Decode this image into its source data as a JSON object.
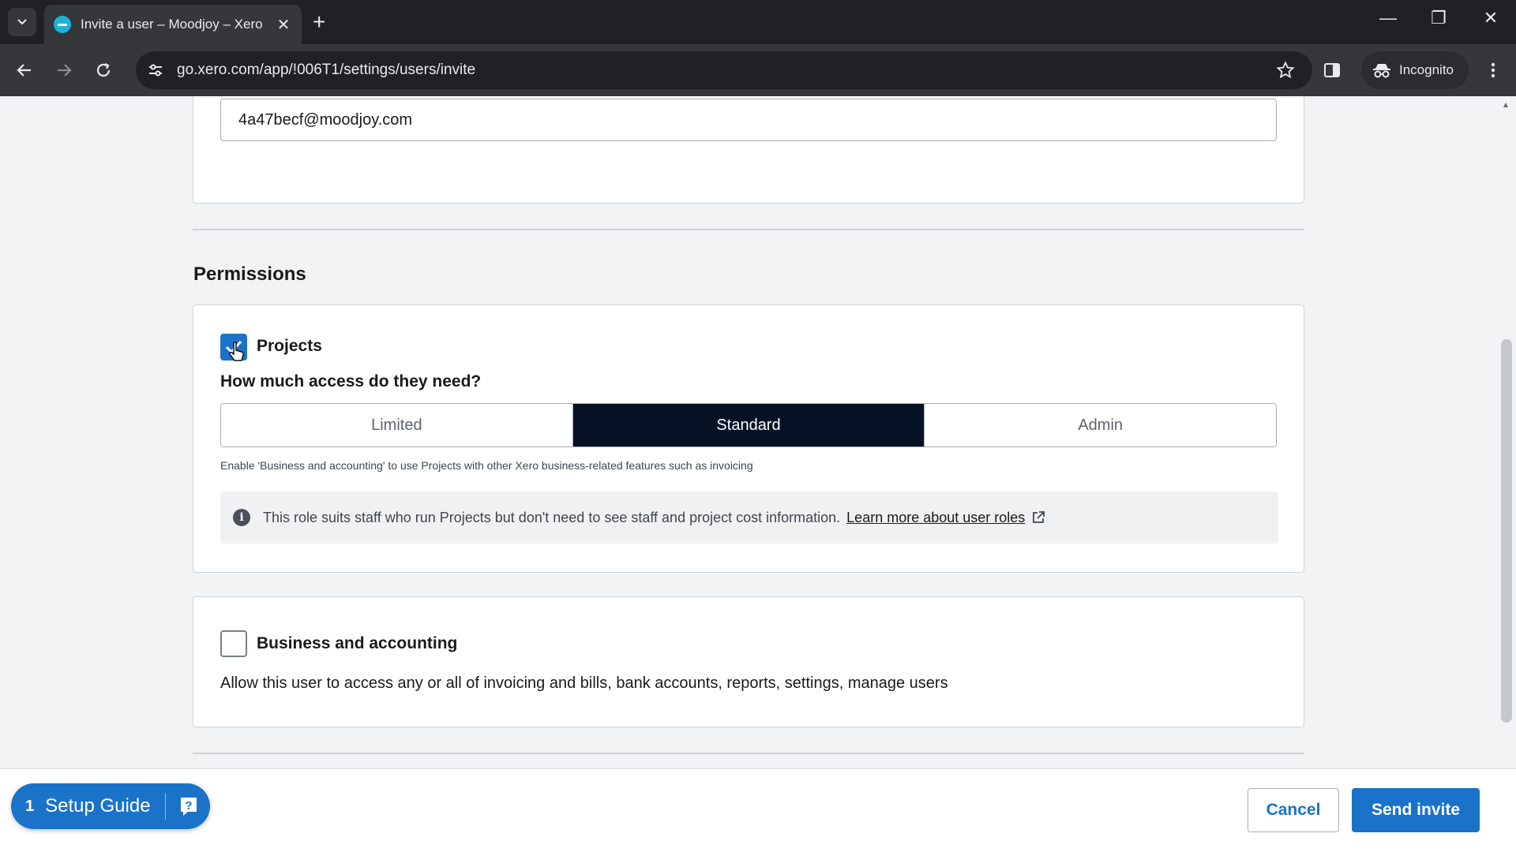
{
  "browser": {
    "tab_title": "Invite a user – Moodjoy – Xero",
    "url": "go.xero.com/app/!006T1/settings/users/invite",
    "incognito_label": "Incognito"
  },
  "form": {
    "email_value": "4a47becf@moodjoy.com",
    "permissions_title": "Permissions",
    "projects": {
      "label": "Projects",
      "checked": true,
      "question": "How much access do they need?",
      "access_options": [
        "Limited",
        "Standard",
        "Admin"
      ],
      "selected_access": "Standard",
      "hint": "Enable 'Business and accounting' to use Projects with other Xero business-related features such as invoicing",
      "info_text": "This role suits staff who run Projects but don't need to see staff and project cost information.",
      "info_link": "Learn more about user roles"
    },
    "business": {
      "label": "Business and accounting",
      "checked": false,
      "description": "Allow this user to access any or all of invoicing and bills, bank accounts, reports, settings, manage users"
    }
  },
  "footer": {
    "setup_guide_count": "1",
    "setup_guide_label": "Setup Guide",
    "cancel_label": "Cancel",
    "send_label": "Send invite"
  },
  "colors": {
    "accent": "#1b73c9",
    "selected_segment": "#061224",
    "chrome_dark": "#1f2124"
  }
}
